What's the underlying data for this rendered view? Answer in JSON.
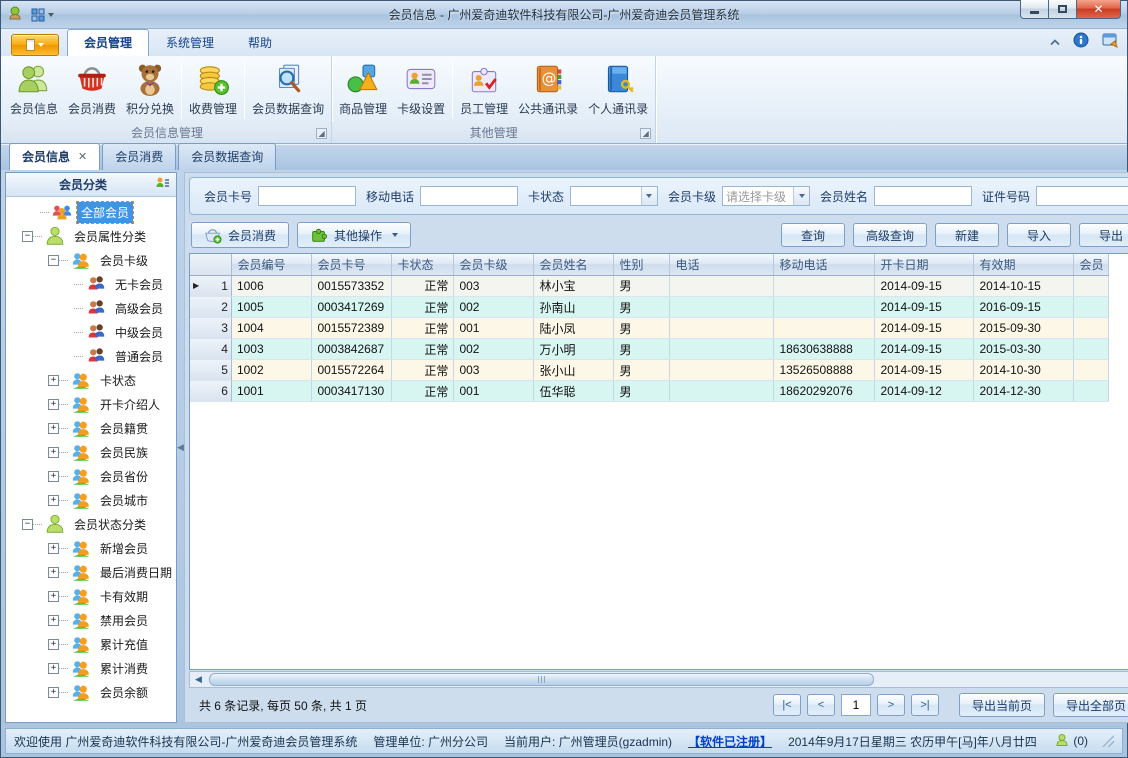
{
  "window": {
    "title": "会员信息 - 广州爱奇迪软件科技有限公司-广州爱奇迪会员管理系统"
  },
  "menubar": {
    "tabs": [
      {
        "label": "会员管理",
        "active": true
      },
      {
        "label": "系统管理",
        "active": false
      },
      {
        "label": "帮助",
        "active": false
      }
    ]
  },
  "ribbon": {
    "groups": [
      {
        "label": "会员信息管理",
        "buttons": [
          {
            "label": "会员信息",
            "icon": "members-icon"
          },
          {
            "label": "会员消费",
            "icon": "basket-icon"
          },
          {
            "label": "积分兑换",
            "icon": "teddy-icon"
          },
          {
            "label": "收费管理",
            "icon": "coins-icon"
          },
          {
            "label": "会员数据查询",
            "icon": "search-docs-icon"
          }
        ]
      },
      {
        "label": "其他管理",
        "buttons": [
          {
            "label": "商品管理",
            "icon": "goods-icon"
          },
          {
            "label": "卡级设置",
            "icon": "card-icon"
          },
          {
            "label": "员工管理",
            "icon": "staff-icon"
          },
          {
            "label": "公共通讯录",
            "icon": "public-contacts-icon"
          },
          {
            "label": "个人通讯录",
            "icon": "personal-contacts-icon"
          }
        ]
      }
    ]
  },
  "doc_tabs": [
    {
      "label": "会员信息",
      "active": true,
      "closable": true
    },
    {
      "label": "会员消费",
      "active": false
    },
    {
      "label": "会员数据查询",
      "active": false
    }
  ],
  "sidebar": {
    "title": "会员分类",
    "tree": [
      {
        "label": "全部会员",
        "level": 0,
        "expand": null,
        "icon": "all-members",
        "selected": true
      },
      {
        "label": "会员属性分类",
        "level": 0,
        "expand": "minus",
        "icon": "category-person"
      },
      {
        "label": "会员卡级",
        "level": 1,
        "expand": "minus",
        "icon": "subcategory-people"
      },
      {
        "label": "无卡会员",
        "level": 2,
        "expand": null,
        "icon": "member-pair"
      },
      {
        "label": "高级会员",
        "level": 2,
        "expand": null,
        "icon": "member-pair"
      },
      {
        "label": "中级会员",
        "level": 2,
        "expand": null,
        "icon": "member-pair"
      },
      {
        "label": "普通会员",
        "level": 2,
        "expand": null,
        "icon": "member-pair"
      },
      {
        "label": "卡状态",
        "level": 1,
        "expand": "plus",
        "icon": "subcategory-people"
      },
      {
        "label": "开卡介绍人",
        "level": 1,
        "expand": "plus",
        "icon": "subcategory-people"
      },
      {
        "label": "会员籍贯",
        "level": 1,
        "expand": "plus",
        "icon": "subcategory-people"
      },
      {
        "label": "会员民族",
        "level": 1,
        "expand": "plus",
        "icon": "subcategory-people"
      },
      {
        "label": "会员省份",
        "level": 1,
        "expand": "plus",
        "icon": "subcategory-people"
      },
      {
        "label": "会员城市",
        "level": 1,
        "expand": "plus",
        "icon": "subcategory-people"
      },
      {
        "label": "会员状态分类",
        "level": 0,
        "expand": "minus",
        "icon": "category-person"
      },
      {
        "label": "新增会员",
        "level": 1,
        "expand": "plus",
        "icon": "subcategory-people"
      },
      {
        "label": "最后消费日期",
        "level": 1,
        "expand": "plus",
        "icon": "subcategory-people"
      },
      {
        "label": "卡有效期",
        "level": 1,
        "expand": "plus",
        "icon": "subcategory-people"
      },
      {
        "label": "禁用会员",
        "level": 1,
        "expand": "plus",
        "icon": "subcategory-people"
      },
      {
        "label": "累计充值",
        "level": 1,
        "expand": "plus",
        "icon": "subcategory-people"
      },
      {
        "label": "累计消费",
        "level": 1,
        "expand": "plus",
        "icon": "subcategory-people"
      },
      {
        "label": "会员余额",
        "level": 1,
        "expand": "plus",
        "icon": "subcategory-people"
      }
    ]
  },
  "filters": {
    "items": [
      {
        "label": "会员卡号",
        "type": "input",
        "value": ""
      },
      {
        "label": "移动电话",
        "type": "input",
        "value": ""
      },
      {
        "label": "卡状态",
        "type": "select",
        "value": ""
      },
      {
        "label": "会员卡级",
        "type": "select",
        "value": "请选择卡级"
      },
      {
        "label": "会员姓名",
        "type": "input",
        "value": ""
      },
      {
        "label": "证件号码",
        "type": "input",
        "value": ""
      }
    ]
  },
  "toolbar": {
    "consume_label": "会员消费",
    "other_ops_label": "其他操作",
    "right_buttons": [
      "查询",
      "高级查询",
      "新建",
      "导入",
      "导出"
    ]
  },
  "grid": {
    "columns": [
      "会员编号",
      "会员卡号",
      "卡状态",
      "会员卡级",
      "会员姓名",
      "性别",
      "电话",
      "移动电话",
      "开卡日期",
      "有效期",
      "会员"
    ],
    "row_numbers": [
      1,
      2,
      3,
      4,
      5,
      6
    ],
    "current_row": 1,
    "rows": [
      [
        "1006",
        "0015573352",
        "正常",
        "003",
        "林小宝",
        "男",
        "",
        "",
        "2014-09-15",
        "2014-10-15",
        ""
      ],
      [
        "1005",
        "0003417269",
        "正常",
        "002",
        "孙南山",
        "男",
        "",
        "",
        "2014-09-15",
        "2016-09-15",
        ""
      ],
      [
        "1004",
        "0015572389",
        "正常",
        "001",
        "陆小凤",
        "男",
        "",
        "",
        "2014-09-15",
        "2015-09-30",
        ""
      ],
      [
        "1003",
        "0003842687",
        "正常",
        "002",
        "万小明",
        "男",
        "",
        "18630638888",
        "2014-09-15",
        "2015-03-30",
        ""
      ],
      [
        "1002",
        "0015572264",
        "正常",
        "003",
        "张小山",
        "男",
        "",
        "13526508888",
        "2014-09-15",
        "2014-10-30",
        ""
      ],
      [
        "1001",
        "0003417130",
        "正常",
        "001",
        "伍华聪",
        "男",
        "",
        "18620292076",
        "2014-09-12",
        "2014-12-30",
        ""
      ]
    ]
  },
  "pagination": {
    "summary": "共 6 条记录, 每页 50 条, 共 1 页",
    "first": "|<",
    "prev": "<",
    "page": "1",
    "next": ">",
    "last": ">|",
    "export_current": "导出当前页",
    "export_all": "导出全部页"
  },
  "statusbar": {
    "welcome": "欢迎使用 广州爱奇迪软件科技有限公司-广州爱奇迪会员管理系统",
    "unit": "管理单位: 广州分公司",
    "user": "当前用户: 广州管理员(gzadmin)",
    "registered": "【软件已注册】",
    "datetime": "2014年9月17日星期三 农历甲午[马]年八月廿四",
    "online_count": "(0)"
  }
}
